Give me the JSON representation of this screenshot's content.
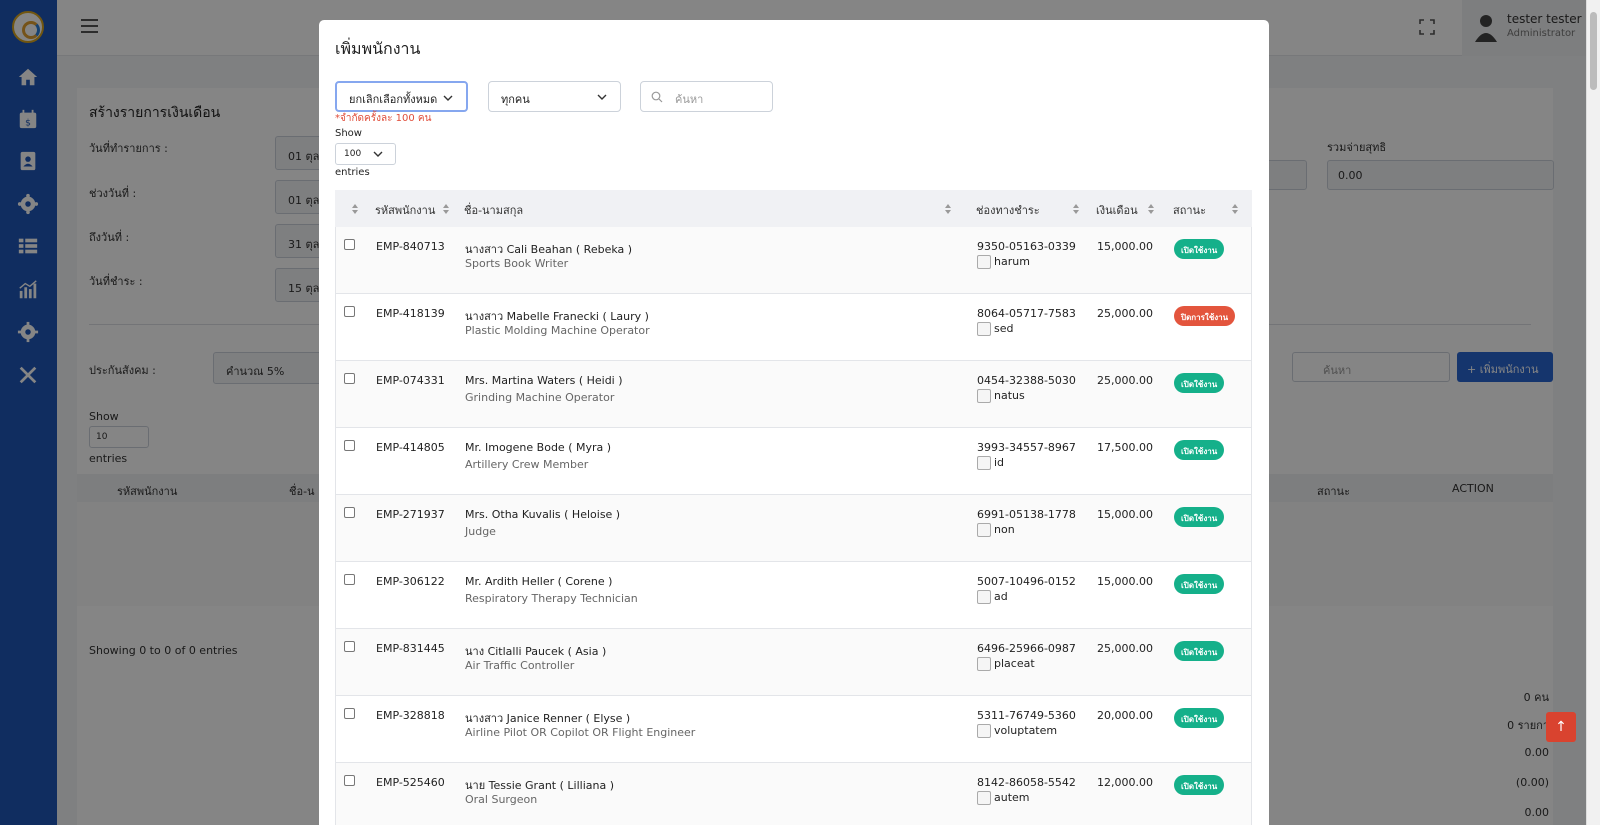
{
  "colors": {
    "sidebar": "#1f57b8",
    "primary": "#2a66d2",
    "active_badge": "#15b08a",
    "inactive_badge": "#e3553d",
    "limit_note": "#e04d3a"
  },
  "sidebar": {
    "icons": [
      "home-icon",
      "calendar-dollar-icon",
      "address-card-icon",
      "users-cog-icon",
      "list-icon",
      "chart-bar-icon",
      "settings-icon",
      "tools-icon"
    ]
  },
  "topbar": {
    "user_name": "tester tester",
    "user_role": "Administrator"
  },
  "background_page": {
    "title": "สร้างรายการเงินเดือน",
    "fields": [
      {
        "label": "วันที่ทำรายการ :",
        "value": "01 ตุล"
      },
      {
        "label": "ช่วงวันที่ :",
        "value": "01 ตุล"
      },
      {
        "label": "ถึงวันที่ :",
        "value": "31 ตุล"
      },
      {
        "label": "วันที่ชำระ :",
        "value": "15 ตุล"
      }
    ],
    "net_total_label": "รวมจ่ายสุทธิ",
    "net_total_value": "0.00",
    "social_security_label": "ประกันสังคม :",
    "social_security_value": "คำนวณ 5%",
    "search_placeholder": "ค้นหา",
    "add_button": "+ เพิ่มพนักงาน",
    "show_label": "Show",
    "length_value": "10",
    "entries_label": "entries",
    "table_headers": [
      "รหัสพนักงาน",
      "ชื่อ-น",
      "สถานะ",
      "ACTION"
    ],
    "showing_text": "Showing 0 to 0 of 0 entries",
    "summary": [
      "0 คน",
      "0 รายกา",
      "0.00",
      "(0.00)",
      "0.00"
    ]
  },
  "modal": {
    "title": "เพิ่มพนักงาน",
    "deselect_all": "ยกเลิกเลือกทั้งหมด",
    "filter_value": "ทุกคน",
    "search_placeholder": "ค้นหา",
    "limit_note": "*จำกัดครั้งละ 100 คน",
    "show_label": "Show",
    "length_value": "100",
    "entries_label": "entries",
    "headers": {
      "code": "รหัสพนักงาน",
      "name": "ชื่อ-นามสกุล",
      "account": "ช่องทางชำระ",
      "salary": "เงินเดือน",
      "status": "สถานะ"
    },
    "rows": [
      {
        "code": "EMP-840713",
        "name": "นางสาว Cali Beahan ( Rebeka )",
        "position": "Sports Book Writer",
        "account": "9350-05163-0339",
        "bank": "harum",
        "salary": "15,000.00",
        "status": "เปิดใช้งาน",
        "active": true
      },
      {
        "code": "EMP-418139",
        "name": "นางสาว Mabelle Franecki ( Laury )",
        "position": "Plastic Molding Machine Operator",
        "account": "8064-05717-7583",
        "bank": "sed",
        "salary": "25,000.00",
        "status": "ปิดการใช้งาน",
        "active": false
      },
      {
        "code": "EMP-074331",
        "name": "Mrs. Martina Waters ( Heidi )",
        "position": "Grinding Machine Operator",
        "account": "0454-32388-5030",
        "bank": "natus",
        "salary": "25,000.00",
        "status": "เปิดใช้งาน",
        "active": true
      },
      {
        "code": "EMP-414805",
        "name": "Mr. Imogene Bode ( Myra )",
        "position": "Artillery Crew Member",
        "account": "3993-34557-8967",
        "bank": "id",
        "salary": "17,500.00",
        "status": "เปิดใช้งาน",
        "active": true
      },
      {
        "code": "EMP-271937",
        "name": "Mrs. Otha Kuvalis ( Heloise )",
        "position": "Judge",
        "account": "6991-05138-1778",
        "bank": "non",
        "salary": "15,000.00",
        "status": "เปิดใช้งาน",
        "active": true
      },
      {
        "code": "EMP-306122",
        "name": "Mr. Ardith Heller ( Corene )",
        "position": "Respiratory Therapy Technician",
        "account": "5007-10496-0152",
        "bank": "ad",
        "salary": "15,000.00",
        "status": "เปิดใช้งาน",
        "active": true
      },
      {
        "code": "EMP-831445",
        "name": "นาง Citlalli Paucek ( Asia )",
        "position": "Air Traffic Controller",
        "account": "6496-25966-0987",
        "bank": "placeat",
        "salary": "25,000.00",
        "status": "เปิดใช้งาน",
        "active": true
      },
      {
        "code": "EMP-328818",
        "name": "นางสาว Janice Renner ( Elyse )",
        "position": "Airline Pilot OR Copilot OR Flight Engineer",
        "account": "5311-76749-5360",
        "bank": "voluptatem",
        "salary": "20,000.00",
        "status": "เปิดใช้งาน",
        "active": true
      },
      {
        "code": "EMP-525460",
        "name": "นาย Tessie Grant ( Lilliana )",
        "position": "Oral Surgeon",
        "account": "8142-86058-5542",
        "bank": "autem",
        "salary": "12,000.00",
        "status": "เปิดใช้งาน",
        "active": true
      }
    ]
  }
}
